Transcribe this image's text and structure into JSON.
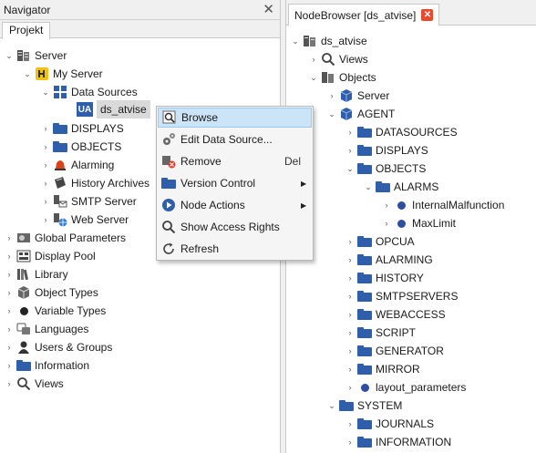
{
  "navigator": {
    "title": "Navigator",
    "close_glyph": "✕",
    "tab": "Projekt",
    "tree": [
      {
        "label": "Server",
        "icon": "server-icon"
      },
      {
        "label": "My Server",
        "icon": "my-server-icon"
      },
      {
        "label": "Data Sources",
        "icon": "data-sources-icon"
      },
      {
        "label": "ds_atvise",
        "icon": "ua-icon",
        "selected": true
      },
      {
        "label": "DISPLAYS",
        "icon": "folder-icon"
      },
      {
        "label": "OBJECTS",
        "icon": "folder-icon"
      },
      {
        "label": "Alarming",
        "icon": "alarm-bell-icon"
      },
      {
        "label": "History Archives",
        "icon": "history-archive-icon"
      },
      {
        "label": "SMTP Server",
        "icon": "smtp-server-icon"
      },
      {
        "label": "Web Server",
        "icon": "web-server-icon"
      },
      {
        "label": "Global Parameters",
        "icon": "global-parameters-icon"
      },
      {
        "label": "Display Pool",
        "icon": "display-pool-icon"
      },
      {
        "label": "Library",
        "icon": "library-icon"
      },
      {
        "label": "Object Types",
        "icon": "object-types-icon"
      },
      {
        "label": "Variable Types",
        "icon": "variable-types-icon"
      },
      {
        "label": "Languages",
        "icon": "languages-icon"
      },
      {
        "label": "Users & Groups",
        "icon": "users-icon"
      },
      {
        "label": "Information",
        "icon": "information-folder-icon"
      },
      {
        "label": "Views",
        "icon": "views-search-icon"
      }
    ],
    "ua_badge": "UA"
  },
  "context_menu": {
    "items": [
      {
        "label": "Browse",
        "shortcut": "",
        "icon": "browse-icon",
        "highlighted": true
      },
      {
        "label": "Edit Data Source...",
        "shortcut": "",
        "icon": "gears-icon"
      },
      {
        "label": "Remove",
        "shortcut": "Del",
        "icon": "remove-icon"
      },
      {
        "label": "Version Control",
        "shortcut": "",
        "icon": "folder-icon",
        "submenu": true
      },
      {
        "label": "Node Actions",
        "shortcut": "",
        "icon": "play-icon",
        "submenu": true
      },
      {
        "label": "Show Access Rights",
        "shortcut": "",
        "icon": "search-icon"
      },
      {
        "label": "Refresh",
        "shortcut": "",
        "icon": "refresh-icon"
      }
    ]
  },
  "node_browser": {
    "tab_title": "NodeBrowser [ds_atvise]",
    "tab_close": "✕",
    "tree": [
      {
        "label": "ds_atvise"
      },
      {
        "label": "Views"
      },
      {
        "label": "Objects"
      },
      {
        "label": "Server"
      },
      {
        "label": "AGENT"
      },
      {
        "label": "DATASOURCES"
      },
      {
        "label": "DISPLAYS"
      },
      {
        "label": "OBJECTS"
      },
      {
        "label": "ALARMS"
      },
      {
        "label": "InternalMalfunction"
      },
      {
        "label": "MaxLimit"
      },
      {
        "label": "OPCUA"
      },
      {
        "label": "ALARMING"
      },
      {
        "label": "HISTORY"
      },
      {
        "label": "SMTPSERVERS"
      },
      {
        "label": "WEBACCESS"
      },
      {
        "label": "SCRIPT"
      },
      {
        "label": "GENERATOR"
      },
      {
        "label": "MIRROR"
      },
      {
        "label": "layout_parameters"
      },
      {
        "label": "SYSTEM"
      },
      {
        "label": "JOURNALS"
      },
      {
        "label": "INFORMATION"
      }
    ]
  },
  "colors": {
    "accent_blue": "#2f5eaa",
    "highlight": "#cce4f7",
    "tab_close": "#e8492e",
    "alarm": "#d9421b"
  }
}
